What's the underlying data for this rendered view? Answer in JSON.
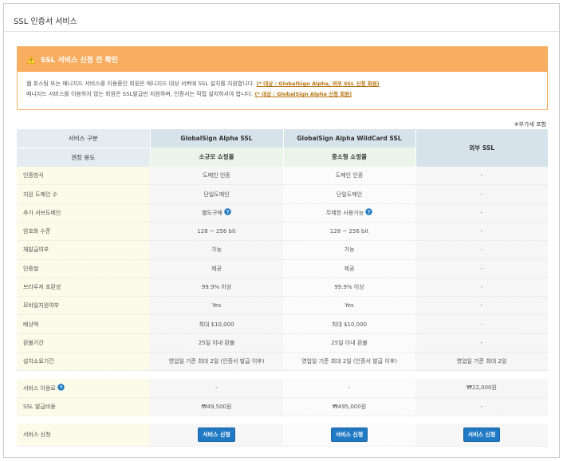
{
  "page": {
    "title": "SSL 인증서 서비스"
  },
  "notice": {
    "title": "SSL 서비스 신청 전 확인",
    "line1": "웹 호스팅 또는 매니지드 서비스를 이용중인 회원은 매니지드 대상 서버에 SSL 설치를 지원합니다.",
    "line1_link": "(* 대상 : GlobalSign Alpha, 외부 SSL 신청 회원)",
    "line2": "매니지드 서비스를 이용하지 않는 회원은 SSL발급만 지원하며, 인증서는 직접 설치하셔야 합니다.",
    "line2_link": "(* 대상 : GlobalSign Alpha 신청 회원)",
    "icon": "warning-icon"
  },
  "vat_note": "※부가세 포함",
  "table": {
    "header": {
      "label1": "서비스 구분",
      "label2": "권장 용도",
      "col1": "GlobalSign Alpha SSL",
      "col1_sub": "소규모 쇼핑몰",
      "col2": "GlobalSign Alpha WildCard SSL",
      "col2_sub": "중소형 쇼핑몰",
      "col3": "외부 SSL"
    },
    "rows": [
      {
        "label": "인증방식",
        "c1": "도메인 인증",
        "c2": "도메인 인증",
        "c3": "-"
      },
      {
        "label": "지원 도메인 수",
        "c1": "단일도메인",
        "c2": "단일도메인",
        "c3": "-"
      },
      {
        "label": "추가 서브도메인",
        "c1": "별도구매",
        "c2": "무제한 사용가능",
        "c3": "-"
      },
      {
        "label": "암호화 수준",
        "c1": "128 ~ 256 bit",
        "c2": "128 ~ 256 bit",
        "c3": "-"
      },
      {
        "label": "재발급여부",
        "c1": "가능",
        "c2": "가능",
        "c3": "-"
      },
      {
        "label": "인증씰",
        "c1": "제공",
        "c2": "제공",
        "c3": "-"
      },
      {
        "label": "브라우저 호환성",
        "c1": "99.9% 이상",
        "c2": "99.9% 이상",
        "c3": "-"
      },
      {
        "label": "모바일지원여부",
        "c1": "Yes",
        "c2": "Yes",
        "c3": "-"
      },
      {
        "label": "배상액",
        "c1": "최대 $10,000",
        "c2": "최대 $10,000",
        "c3": "-"
      },
      {
        "label": "환불기간",
        "c1": "25일 이내 환불",
        "c2": "25일 이내 환불",
        "c3": "-"
      },
      {
        "label": "설치소요기간",
        "c1": "영업일 기준 최대 2일 (인증서 발급 이후)",
        "c2": "영업일 기준 최대 2일 (인증서 발급 이후)",
        "c3": "영업일 기준 최대 2일"
      }
    ],
    "fee": {
      "label": "서비스 이용료",
      "c1": "-",
      "c2": "-",
      "c3": "₩22,000원"
    },
    "issue": {
      "label": "SSL 발급비용",
      "c1": "₩49,500원",
      "c2": "₩495,000원",
      "c3": "-"
    },
    "apply": {
      "label": "서비스 신청",
      "button": "서비스 신청"
    }
  }
}
